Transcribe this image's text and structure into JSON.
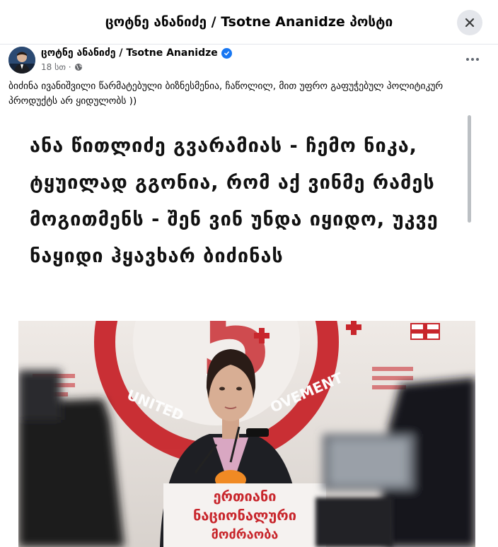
{
  "modal": {
    "title": "ცოტნე ანანიძე / Tsotne Ananidze პოსტი",
    "close_icon": "close-icon"
  },
  "post": {
    "author": "ცოტნე ანანიძე / Tsotne Ananidze",
    "verified_icon": "verified-badge-icon",
    "time": "18 სთ ·",
    "audience_icon": "globe-icon",
    "more_icon": "more-options-icon",
    "text": "ბიძინა ივანიშვილი წარმატებული ბიზნესმენია, ჩაწოლილ, მით უფრო გაფუჭებულ პოლიტიკურ პროდუქტს არ ყიდულობს ))"
  },
  "image": {
    "headline": "ანა წითლიძე გვარამიას - ჩემო ნიკა, ტყუილად გგონია, რომ აქ ვინმე რამეს მოგითმენს - შენ ვინ უნდა იყიდო, უკვე ნაყიდი ჰყავხარ ბიძინას",
    "backdrop_text": "UNITED NATIONAL MOVEMENT",
    "logo_number": "5",
    "podium_sign": [
      "ერთიანი",
      "ნაციონალური",
      "მოძრაობა"
    ],
    "colors": {
      "brand_red": "#c8262c",
      "backdrop": "#e9e4e0"
    }
  }
}
